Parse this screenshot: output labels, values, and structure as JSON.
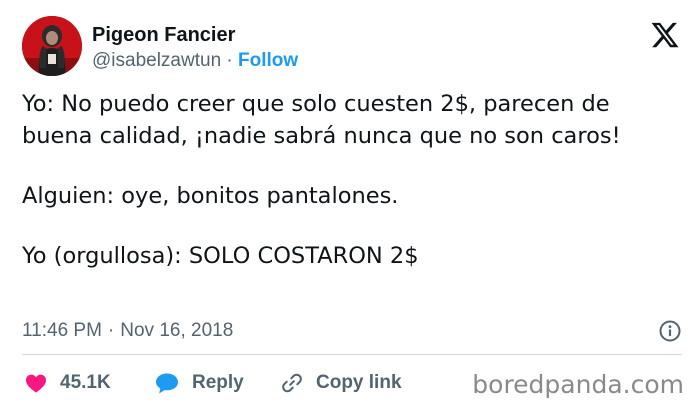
{
  "author": {
    "display_name": "Pigeon Fancier",
    "handle": "@isabelzawtun",
    "separator": "·",
    "follow_label": "Follow"
  },
  "tweet": {
    "lines": [
      "Yo: No puedo creer que solo cuesten 2$, parecen de",
      "buena calidad, ¡nadie sabrá nunca que no son caros!",
      "Alguien: oye, bonitos pantalones.",
      "Yo (orgullosa): SOLO COSTARON 2$"
    ],
    "time": "11:46 PM",
    "separator": "·",
    "date": "Nov 16, 2018"
  },
  "actions": {
    "likes_count": "45.1K",
    "reply_label": "Reply",
    "copy_link_label": "Copy link"
  },
  "watermark": "boredpanda.com",
  "icons": {
    "brand": "x-logo-icon",
    "info": "info-icon",
    "like": "heart-icon",
    "reply": "reply-bubble-icon",
    "copy": "link-icon"
  },
  "colors": {
    "accent": "#1d9bf0",
    "like": "#f91880",
    "text": "#0f1419",
    "muted": "#536471"
  }
}
